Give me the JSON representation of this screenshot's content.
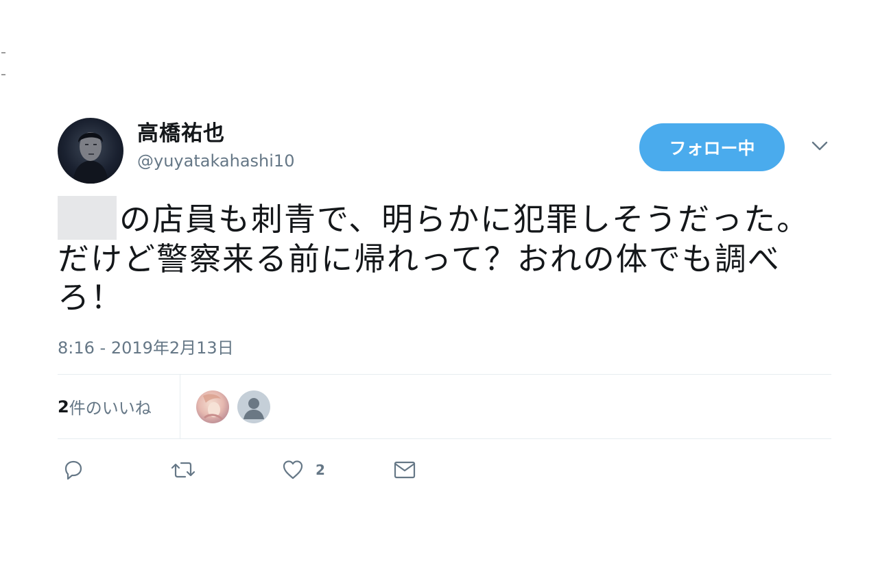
{
  "tweet": {
    "display_name": "高橋祐也",
    "screen_name": "@yuyatakahashi10",
    "follow_label": "フォロー中",
    "text": "の店員も刺青で、明らかに犯罪しそうだった。だけど警察来る前に帰れって？おれの体でも調べろ！",
    "timestamp": "8:16 - 2019年2月13日",
    "likes_number": "2",
    "likes_suffix": "件のいいね",
    "like_count": "2"
  },
  "icons": {
    "menu": "chevron-down-icon",
    "reply": "reply-icon",
    "retweet": "retweet-icon",
    "like": "heart-icon",
    "dm": "envelope-icon"
  },
  "colors": {
    "accent": "#4aabed",
    "secondary_text": "#657786",
    "primary_text": "#14171a",
    "divider": "#e6ecf0"
  }
}
